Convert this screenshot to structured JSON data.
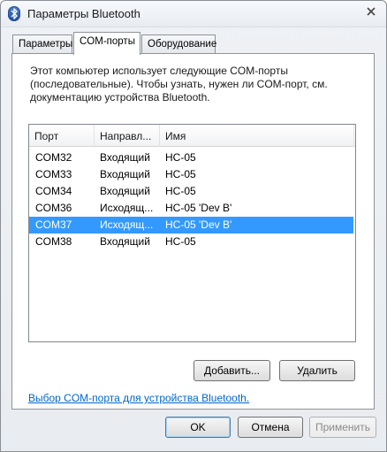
{
  "window": {
    "title": "Параметры Bluetooth"
  },
  "tabs": [
    {
      "label": "Параметры"
    },
    {
      "label": "COM-порты"
    },
    {
      "label": "Оборудование"
    }
  ],
  "panel": {
    "description": "Этот компьютер использует следующие COM-порты (последовательные). Чтобы узнать, нужен ли COM-порт, см. документацию устройства Bluetooth.",
    "columns": [
      "Порт",
      "Направл...",
      "Имя"
    ],
    "rows": [
      [
        "COM32",
        "Входящий",
        "HC-05"
      ],
      [
        "COM33",
        "Входящий",
        "HC-05"
      ],
      [
        "COM34",
        "Входящий",
        "HC-05"
      ],
      [
        "COM36",
        "Исходящ...",
        "HC-05 'Dev B'"
      ],
      [
        "COM37",
        "Исходящ...",
        "HC-05 'Dev B'"
      ],
      [
        "COM38",
        "Входящий",
        "HC-05"
      ]
    ],
    "selected_row": 4,
    "add_button": "Добавить...",
    "remove_button": "Удалить",
    "link": "Выбор COM-порта для устройства Bluetooth."
  },
  "footer": {
    "ok": "OK",
    "cancel": "Отмена",
    "apply": "Применить"
  },
  "colors": {
    "selection": "#3399ff",
    "link": "#0066cc"
  }
}
